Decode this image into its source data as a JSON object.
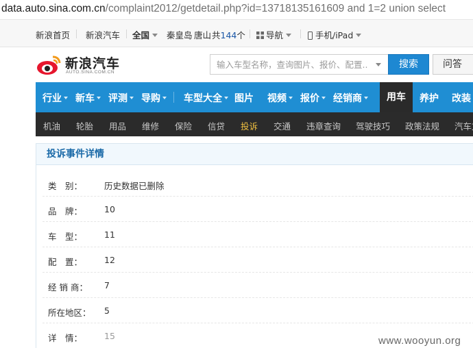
{
  "browser": {
    "url_host": "data.auto.sina.com.cn",
    "url_path": "/complaint2012/getdetail.php?id=13718135161609 and 1=2 union select"
  },
  "topnav": {
    "home": "新浪首页",
    "auto": "新浪汽车",
    "region": "全国",
    "city1": "秦皇岛",
    "city2": "唐山",
    "count_prefix": "共",
    "count": "144",
    "count_suffix": "个",
    "nav": "导航",
    "mobile": "手机/iPad"
  },
  "header": {
    "logo_text": "新浪汽车",
    "logo_sub": "AUTO.SINA.COM.CN",
    "search_placeholder": "输入车型名称，查询图片、报价、配置...",
    "search_button": "搜索",
    "ask_button": "问答"
  },
  "mainnav": {
    "items": [
      "行业",
      "新车",
      "评测",
      "导购",
      "车型大全",
      "图片",
      "视频",
      "报价",
      "经销商"
    ],
    "active": "用车",
    "after": [
      "养护",
      "改装"
    ]
  },
  "subnav": {
    "items": [
      "机油",
      "轮胎",
      "用品",
      "维修",
      "保险",
      "信贷",
      "投诉",
      "交通",
      "违章查询",
      "驾驶技巧",
      "政策法规",
      "汽车文"
    ],
    "selected_index": 6
  },
  "detail": {
    "title": "投诉事件详情",
    "rows": [
      {
        "label": "类　别：",
        "value": "历史数据已删除"
      },
      {
        "label": "品　牌：",
        "value": "10"
      },
      {
        "label": "车　型：",
        "value": "11"
      },
      {
        "label": "配　置：",
        "value": "12"
      },
      {
        "label": "经 销 商：",
        "value": "7"
      },
      {
        "label": "所在地区：",
        "value": "5"
      },
      {
        "label": "详　情：",
        "value": "15"
      }
    ]
  },
  "watermark": "www.wooyun.org",
  "colors": {
    "nav_blue": "#1f8ed3",
    "subnav_dark": "#2b2b2b",
    "subnav_selected": "#f0c040",
    "link_blue": "#1a56a6",
    "search_blue": "#1e88d2"
  }
}
